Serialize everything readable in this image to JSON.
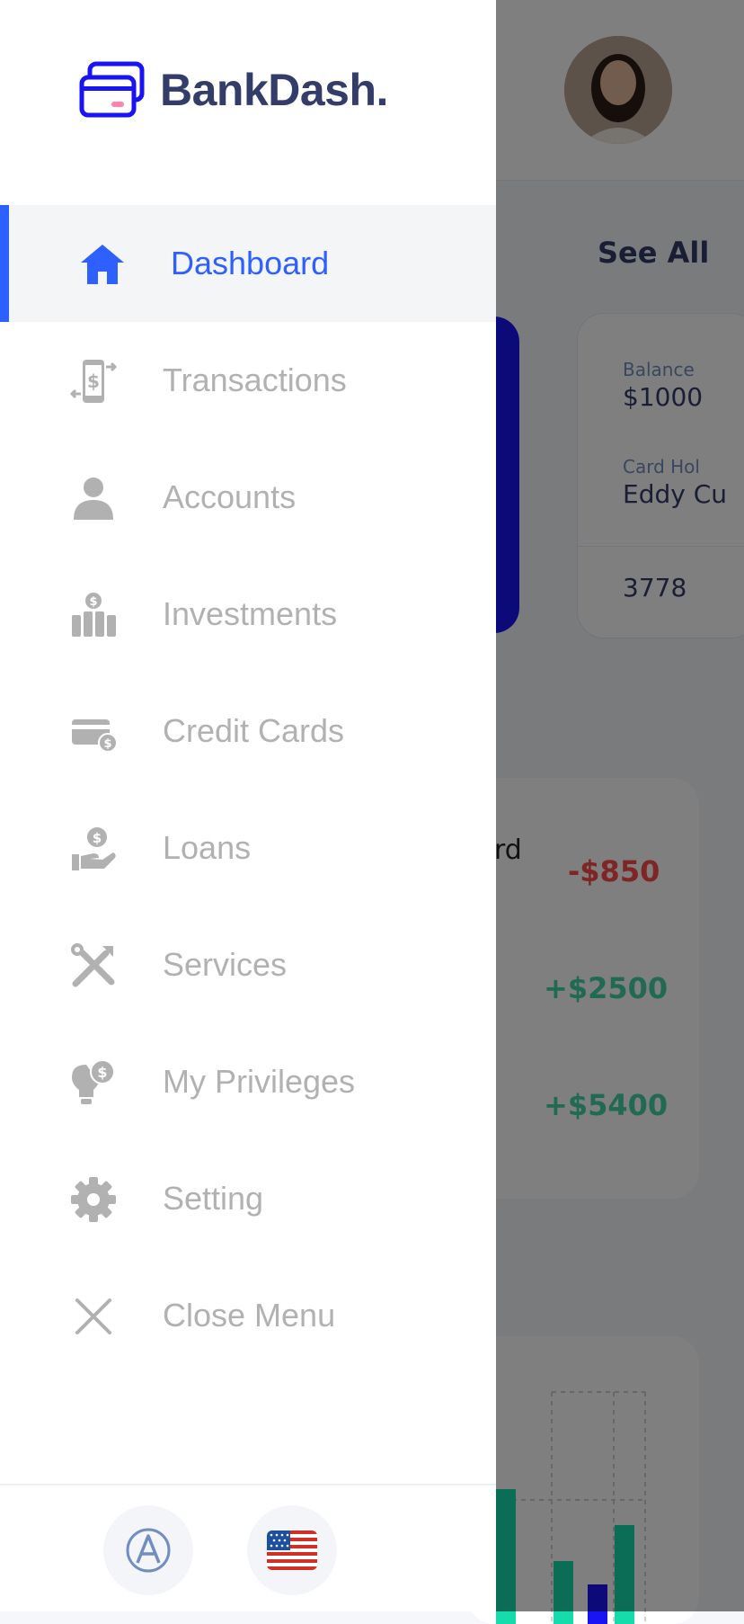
{
  "app": {
    "brand_name": "BankDash."
  },
  "background": {
    "see_all_label": "See All",
    "card": {
      "balance_label": "Balance",
      "balance_value": "$1000",
      "card_holder_label": "Card Hol",
      "card_holder_value": "Eddy Cu",
      "card_number": "3778"
    },
    "transactions": {
      "fragment_text": "rd",
      "amounts": [
        "-$850",
        "+$2500",
        "+$5400"
      ]
    }
  },
  "menu": {
    "items": [
      {
        "label": "Dashboard",
        "icon": "home-icon",
        "active": true
      },
      {
        "label": "Transactions",
        "icon": "transfer-icon"
      },
      {
        "label": "Accounts",
        "icon": "user-icon"
      },
      {
        "label": "Investments",
        "icon": "economic-investment-icon"
      },
      {
        "label": "Credit Cards",
        "icon": "credit-card-icon"
      },
      {
        "label": "Loans",
        "icon": "loan-icon"
      },
      {
        "label": "Services",
        "icon": "service-tools-icon"
      },
      {
        "label": "My Privileges",
        "icon": "privilege-lightbulb-icon"
      },
      {
        "label": "Setting",
        "icon": "settings-gear-icon"
      },
      {
        "label": "Close Menu",
        "icon": "close-icon"
      }
    ]
  },
  "footer": {
    "accessibility_icon": "accessibility-icon",
    "language_icon": "us-flag-icon"
  },
  "colors": {
    "accent": "#2D60FF",
    "inactive_text": "#B1B1B1",
    "brand_text": "#343C6A",
    "negative": "#FF4B4A",
    "positive": "#41D4A8"
  }
}
